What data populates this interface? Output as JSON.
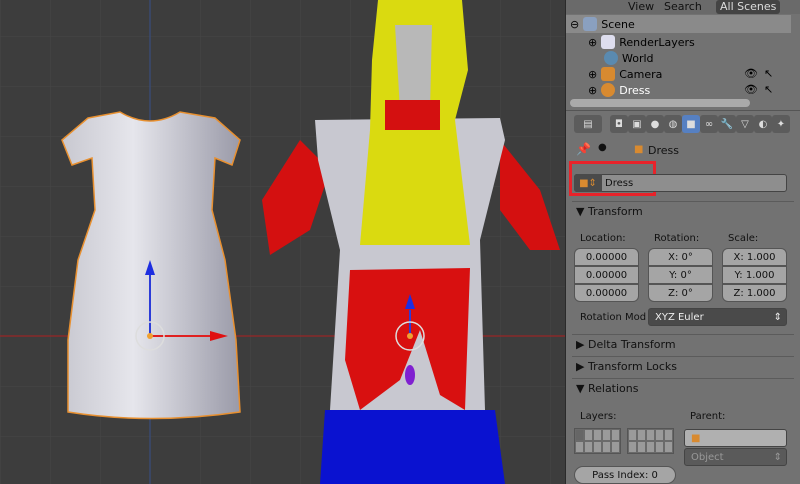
{
  "outliner": {
    "header": {
      "view": "View",
      "search": "Search",
      "scenes": "All Scenes"
    },
    "items": [
      {
        "label": "Scene",
        "icon": "scene-icon"
      },
      {
        "label": "RenderLayers",
        "icon": "render-layers-icon"
      },
      {
        "label": "World",
        "icon": "world-icon"
      },
      {
        "label": "Camera",
        "icon": "camera-icon"
      },
      {
        "label": "Dress",
        "icon": "mesh-icon"
      }
    ]
  },
  "properties": {
    "breadcrumb": "Dress",
    "object_name": "Dress",
    "transform": {
      "title": "Transform",
      "location_label": "Location:",
      "rotation_label": "Rotation:",
      "scale_label": "Scale:",
      "location": [
        "0.00000",
        "0.00000",
        "0.00000"
      ],
      "rotation": [
        "X: 0°",
        "Y: 0°",
        "Z: 0°"
      ],
      "scale": [
        "X: 1.000",
        "Y: 1.000",
        "Z: 1.000"
      ],
      "rotation_mode_label": "Rotation Mod",
      "rotation_mode": "XYZ Euler"
    },
    "delta_transform": "Delta Transform",
    "transform_locks": "Transform Locks",
    "relations": {
      "title": "Relations",
      "layers_label": "Layers:",
      "parent_label": "Parent:",
      "parent_type": "Object",
      "pass_index": "Pass Index: 0"
    }
  },
  "colors": {
    "highlight": "#e8232a",
    "accent": "#5680c2",
    "selection": "#f0a030"
  }
}
